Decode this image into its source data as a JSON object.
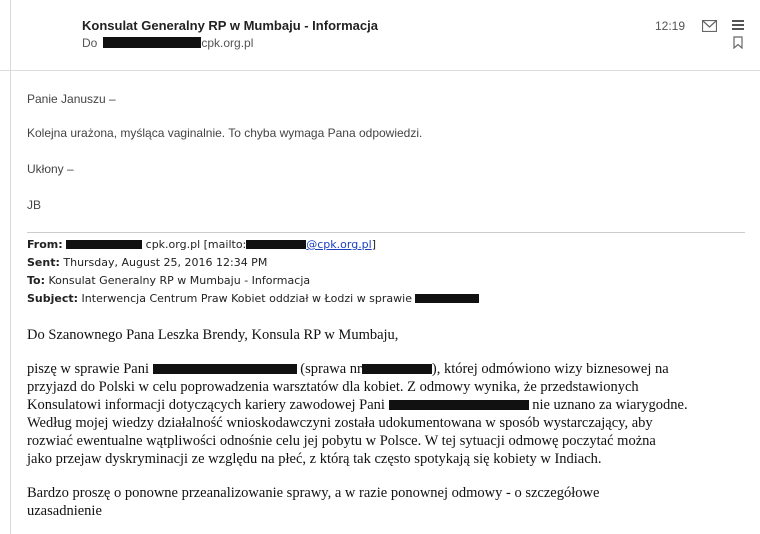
{
  "header": {
    "subject": "Konsulat Generalny RP w Mumbaju - Informacja",
    "to_label": "Do",
    "to_domain": "cpk.org.pl",
    "time": "12:19",
    "icons": [
      "mail-icon",
      "menu-icon",
      "bookmark-icon"
    ]
  },
  "reply": {
    "greeting": "Panie Januszu –",
    "line1": "Kolejna urażona, myśląca vaginalnie. To chyba wymaga Pana odpowiedzi.",
    "closing": "Ukłony –",
    "signature": "JB"
  },
  "forwarded": {
    "from_label": "From:",
    "from_domain": "cpk.org.pl",
    "from_mailto_prefix": "[mailto:",
    "from_mailto_link": "@cpk.org.pl",
    "from_mailto_suffix": "]",
    "sent_label": "Sent:",
    "sent_value": "Thursday, August 25, 2016 12:34 PM",
    "to_label": "To:",
    "to_value": "Konsulat Generalny RP w Mumbaju - Informacja",
    "subject_label": "Subject:",
    "subject_value": "Interwencja Centrum Praw Kobiet oddział w Łodzi w sprawie"
  },
  "letter": {
    "salutation": "Do Szanownego Pana Leszka Brendy, Konsula RP w Mumbaju,",
    "p1_l1a": "piszę w sprawie Pani",
    "p1_l1b": "(sprawa nr",
    "p1_l1c": "), której odmówiono wizy biznesowej na",
    "p1_l2": "przyjazd do Polski w celu poprowadzenia warsztatów dla kobiet. Z odmowy wynika, że przedstawionych",
    "p1_l3a": "Konsulatowi informacji dotyczących kariery zawodowej Pani",
    "p1_l3b": "nie uznano za wiarygodne.",
    "p1_l4": "Według mojej wiedzy działalność wnioskodawczyni została udokumentowana w sposób wystarczający, aby",
    "p1_l5": "rozwiać ewentualne wątpliwości odnośnie celu jej pobytu w Polsce. W tej sytuacji odmowę poczytać można",
    "p1_l6": "jako przejaw dyskryminacji ze względu na płeć, z którą tak często spotykają się kobiety w Indiach.",
    "p2_l1": "Bardzo proszę o ponowne przeanalizowanie sprawy, a w razie ponownej odmowy - o szczegółowe",
    "p2_l2": "uzasadnienie"
  }
}
